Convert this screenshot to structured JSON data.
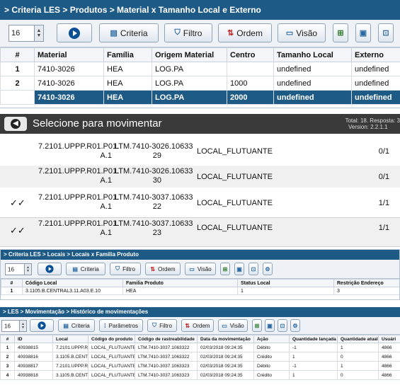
{
  "panel1": {
    "breadcrumb": "> Criteria LES > Produtos > Material x Tamanho Local e Externo",
    "spinner": "16",
    "buttons": {
      "criteria": "Criteria",
      "filtro": "Filtro",
      "ordem": "Ordem",
      "visao": "Visão"
    },
    "columns": [
      "#",
      "Material",
      "Família",
      "Origem Material",
      "Centro",
      "Tamanho Local",
      "Externo"
    ],
    "rows": [
      [
        "1",
        "7410-3026",
        "HEA",
        "LOG.PA",
        "",
        "undefined",
        "undefined"
      ],
      [
        "2",
        "7410-3026",
        "HEA",
        "LOG.PA",
        "1000",
        "undefined",
        "undefined"
      ],
      [
        "",
        "7410-3026",
        "HEA",
        "LOG.PA",
        "2000",
        "undefined",
        "undefined"
      ]
    ]
  },
  "mobile": {
    "title": "Selecione para movimentar",
    "status_line1": "Total: 18. Resposta: 3",
    "status_line2": "Version: 2.2.1.1",
    "items": [
      {
        "checked": false,
        "addr1": "7.2101.UPPP.R01.P01.",
        "addr2": "A.1",
        "prod1": "LTM.7410-3026.10633",
        "prod2": "29",
        "local": "LOCAL_FLUTUANTE",
        "qty": "0/1"
      },
      {
        "checked": false,
        "addr1": "7.2101.UPPP.R01.P01.",
        "addr2": "A.1",
        "prod1": "LTM.7410-3026.10633",
        "prod2": "30",
        "local": "LOCAL_FLUTUANTE",
        "qty": "0/1"
      },
      {
        "checked": true,
        "addr1": "7.2101.UPPP.R01.P01.",
        "addr2": "A.1",
        "prod1": "LTM.7410-3037.10633",
        "prod2": "22",
        "local": "LOCAL_FLUTUANTE",
        "qty": "1/1"
      },
      {
        "checked": true,
        "addr1": "7.2101.UPPP.R01.P01.",
        "addr2": "A.1",
        "prod1": "LTM.7410-3037.10633",
        "prod2": "23",
        "local": "LOCAL_FLUTUANTE",
        "qty": "1/1"
      }
    ]
  },
  "panel2": {
    "breadcrumb": "> Criteria LES > Locais > Locais x Familia Produto",
    "spinner": "16",
    "buttons": {
      "criteria": "Criteria",
      "filtro": "Filtro",
      "ordem": "Ordem",
      "visao": "Visão"
    },
    "columns": [
      "#",
      "Código Local",
      "Familia Produto",
      "Status Local",
      "Restrição Endereço"
    ],
    "rows": [
      [
        "1",
        "3.1105.B.CENTRAL3.11.A03.E.10",
        "HEA",
        "1",
        "3"
      ]
    ]
  },
  "panel3": {
    "breadcrumb": "> LES > Movimentação > Histórico de movimentações",
    "spinner": "16",
    "buttons": {
      "criteria": "Criteria",
      "parametros": "Parâmetros",
      "filtro": "Filtro",
      "ordem": "Ordem",
      "visao": "Visão"
    },
    "columns": [
      "#",
      "ID",
      "Local",
      "Código do produto",
      "Código de rastreabilidade",
      "Data da movimentação",
      "Ação",
      "Quantidade lançada",
      "Quantidade atual",
      "Usuári"
    ],
    "rows": [
      [
        "1",
        "40938815",
        "7.2101.UPPP.R0",
        "LOCAL_FLUTUANTE",
        "LTM.7410-3037.1063322",
        "02/03/2018 09:24:35",
        "Débito",
        "-1",
        "1",
        "4866"
      ],
      [
        "2",
        "40938816",
        "3.1105.B.CENTR",
        "LOCAL_FLUTUANTE",
        "LTM.7410-3037.1063322",
        "02/03/2018 09:24:35",
        "Crédito",
        "1",
        "0",
        "4866"
      ],
      [
        "3",
        "40938817",
        "7.2101.UPPP.R0",
        "LOCAL_FLUTUANTE",
        "LTM.7410-3037.1063323",
        "02/03/2018 09:24:35",
        "Débito",
        "-1",
        "1",
        "4866"
      ],
      [
        "4",
        "40938818",
        "3.1105.B.CENTR",
        "LOCAL_FLUTUANTE",
        "LTM.7410-3037.1063323",
        "02/03/2018 09:24:35",
        "Crédito",
        "1",
        "0",
        "4866"
      ]
    ]
  }
}
